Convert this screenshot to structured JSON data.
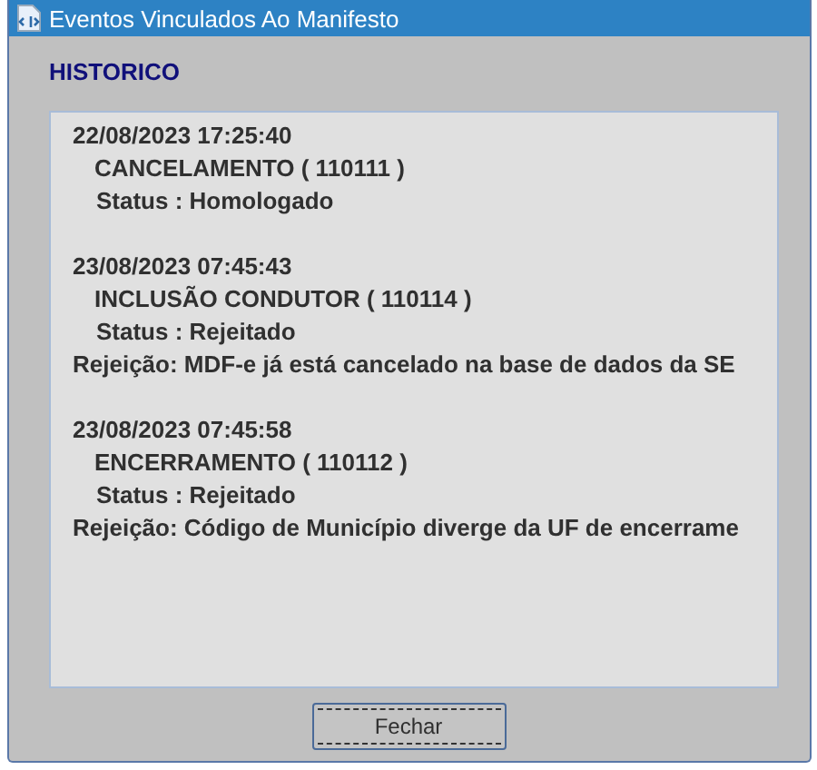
{
  "window": {
    "title": "Eventos Vinculados Ao Manifesto"
  },
  "section_title": "HISTORICO",
  "events": [
    {
      "datetime": "22/08/2023 17:25:40",
      "event": "CANCELAMENTO ( 110111 )",
      "status": "Status : Homologado"
    },
    {
      "datetime": "23/08/2023 07:45:43",
      "event": "INCLUSÃO CONDUTOR ( 110114 )",
      "status": "Status : Rejeitado",
      "rejection": "Rejeição: MDF-e já está cancelado na base de dados da SE"
    },
    {
      "datetime": "23/08/2023 07:45:58",
      "event": "ENCERRAMENTO ( 110112 )",
      "status": "Status : Rejeitado",
      "rejection": "Rejeição: Código de Município diverge da UF de encerrame"
    }
  ],
  "buttons": [
    "Fechar"
  ]
}
